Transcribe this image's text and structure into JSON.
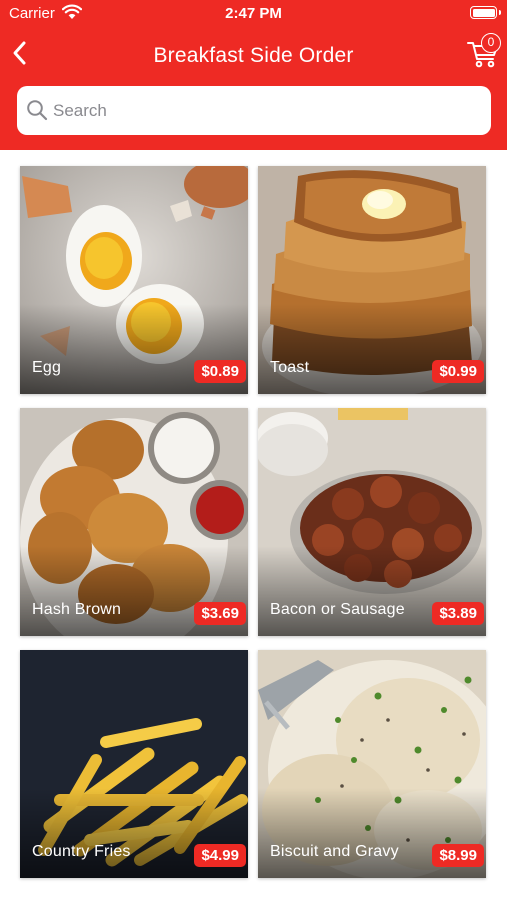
{
  "status_bar": {
    "carrier": "Carrier",
    "time": "2:47 PM"
  },
  "nav": {
    "title": "Breakfast Side Order",
    "back_icon": "chevron-left-icon",
    "cart_icon": "shopping-cart-icon",
    "cart_count": "0"
  },
  "search": {
    "placeholder": "Search",
    "value": ""
  },
  "colors": {
    "brand": "#ee2a24",
    "price_badge": "#ee2a24"
  },
  "items": [
    {
      "name": "Egg",
      "price": "$0.89"
    },
    {
      "name": "Toast",
      "price": "$0.99"
    },
    {
      "name": "Hash Brown",
      "price": "$3.69"
    },
    {
      "name": "Bacon or Sausage",
      "price": "$3.89"
    },
    {
      "name": "Country Fries",
      "price": "$4.99"
    },
    {
      "name": "Biscuit and Gravy",
      "price": "$8.99"
    }
  ]
}
